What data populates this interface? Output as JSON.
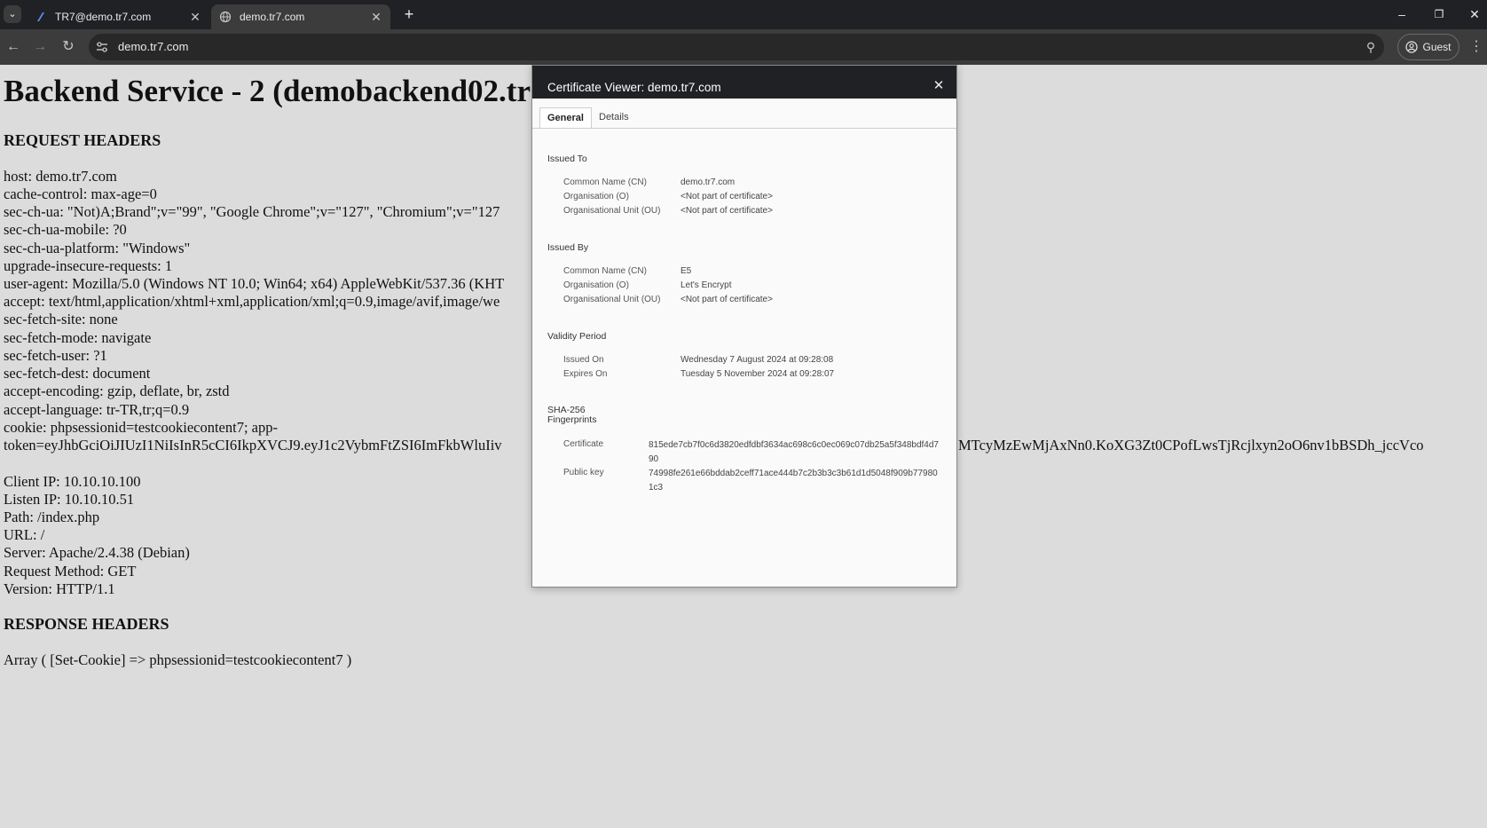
{
  "browser": {
    "tabs": [
      {
        "title": "TR7@demo.tr7.com",
        "icon": "tr7-favicon-icon",
        "active": false
      },
      {
        "title": "demo.tr7.com",
        "icon": "globe-icon",
        "active": true
      }
    ],
    "url": "demo.tr7.com",
    "profile_label": "Guest"
  },
  "page": {
    "heading": "Backend Service - 2 (demobackend02.tr",
    "request_headers_title": "REQUEST HEADERS",
    "request_headers": [
      "host: demo.tr7.com",
      "cache-control: max-age=0",
      "sec-ch-ua: \"Not)A;Brand\";v=\"99\", \"Google Chrome\";v=\"127\", \"Chromium\";v=\"127",
      "sec-ch-ua-mobile: ?0",
      "sec-ch-ua-platform: \"Windows\"",
      "upgrade-insecure-requests: 1",
      "user-agent: Mozilla/5.0 (Windows NT 10.0; Win64; x64) AppleWebKit/537.36 (KHT",
      "accept: text/html,application/xhtml+xml,application/xml;q=0.9,image/avif,image/we",
      "sec-fetch-site: none",
      "sec-fetch-mode: navigate",
      "sec-fetch-user: ?1",
      "sec-fetch-dest: document",
      "accept-encoding: gzip, deflate, br, zstd",
      "accept-language: tr-TR,tr;q=0.9",
      "cookie: phpsessionid=testcookiecontent7; app-",
      "token=eyJhbGciOiJIUzI1NiIsInR5cCI6IkpXVCJ9.eyJ1c2VybmFtZSI6ImFkbWluIiv"
    ],
    "cookie_tail": "MTcyMzEwMjAxNn0.KoXG3Zt0CPofLwsTjRcjlxyn2oO6nv1bBSDh_jccVco",
    "info_lines": [
      "Client IP: 10.10.10.100",
      "Listen IP: 10.10.10.51",
      "Path: /index.php",
      "URL: /",
      "Server: Apache/2.4.38 (Debian)",
      "Request Method: GET",
      "Version: HTTP/1.1"
    ],
    "response_headers_title": "RESPONSE HEADERS",
    "response_line": "Array ( [Set-Cookie] => phpsessionid=testcookiecontent7 )"
  },
  "certificate_viewer": {
    "title": "Certificate Viewer: demo.tr7.com",
    "tabs": {
      "general": "General",
      "details": "Details"
    },
    "issued_to": {
      "heading": "Issued To",
      "fields": [
        {
          "label": "Common Name (CN)",
          "value": "demo.tr7.com"
        },
        {
          "label": "Organisation (O)",
          "value": "<Not part of certificate>"
        },
        {
          "label": "Organisational Unit (OU)",
          "value": "<Not part of certificate>"
        }
      ]
    },
    "issued_by": {
      "heading": "Issued By",
      "fields": [
        {
          "label": "Common Name (CN)",
          "value": "E5"
        },
        {
          "label": "Organisation (O)",
          "value": "Let's Encrypt"
        },
        {
          "label": "Organisational Unit (OU)",
          "value": "<Not part of certificate>"
        }
      ]
    },
    "validity": {
      "heading": "Validity Period",
      "fields": [
        {
          "label": "Issued On",
          "value": "Wednesday 7 August 2024 at 09:28:08"
        },
        {
          "label": "Expires On",
          "value": "Tuesday 5 November 2024 at 09:28:07"
        }
      ]
    },
    "fingerprints": {
      "heading_line1": "SHA-256",
      "heading_line2": "Fingerprints",
      "fields": [
        {
          "label": "Certificate",
          "value": "815ede7cb7f0c6d3820edfdbf3634ac698c6c0ec069c07db25a5f348bdf4d790"
        },
        {
          "label": "Public key",
          "value": "74998fe261e66bddab2ceff71ace444b7c2b3b3c3b61d1d5048f909b779801c3"
        }
      ]
    }
  },
  "colors": {
    "tabstrip": "#202124",
    "toolbar": "#3c3c3c",
    "page_bg": "#dcdcdc",
    "dialog_title_bg": "#202124"
  }
}
